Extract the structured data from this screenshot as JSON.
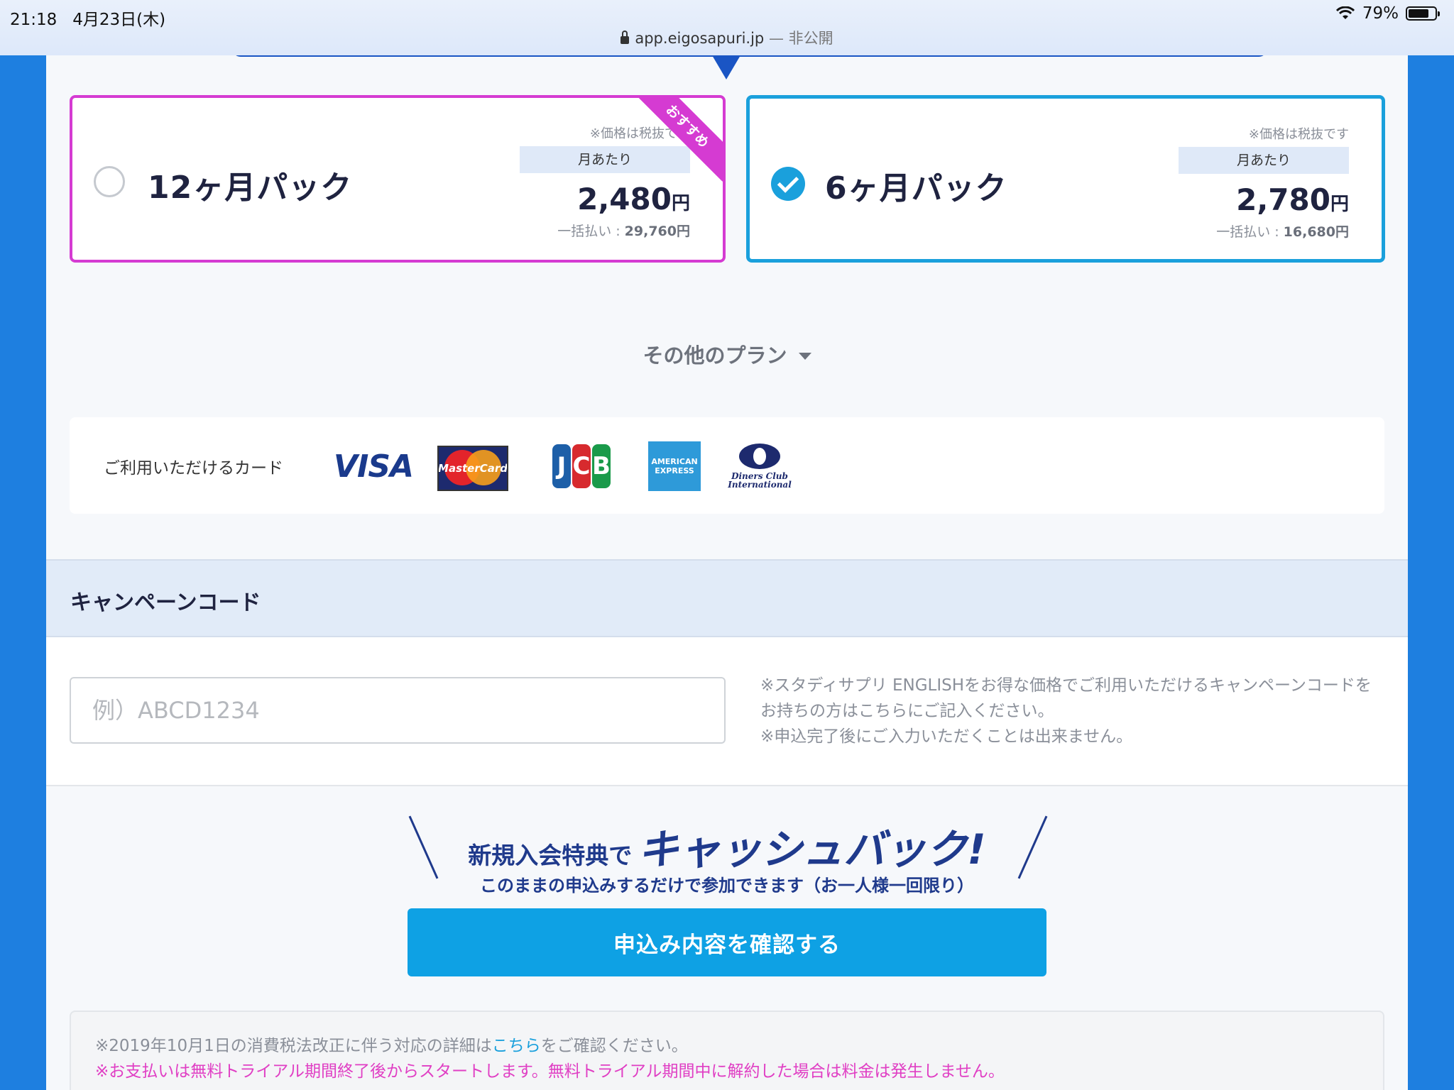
{
  "status_bar": {
    "time": "21:18",
    "date": "4月23日(木)",
    "battery": "79%",
    "battery_level": 0.79
  },
  "url_bar": {
    "domain": "app.eigosapuri.jp",
    "separator": " — ",
    "privacy": "非公開"
  },
  "plans": [
    {
      "name": "12ヶ月パック",
      "selected": false,
      "badge": "おすすめ",
      "tax_note": "※価格は税抜です",
      "per_month_label": "月あたり",
      "price": "2,480",
      "currency": "円",
      "lump_label": "一括払い : ",
      "lump_price": "29,760円",
      "border_color": "#d53bd2"
    },
    {
      "name": "6ヶ月パック",
      "selected": true,
      "tax_note": "※価格は税抜です",
      "per_month_label": "月あたり",
      "price": "2,780",
      "currency": "円",
      "lump_label": "一括払い : ",
      "lump_price": "16,680円",
      "border_color": "#1aa0dc"
    }
  ],
  "other_plans": {
    "label": "その他のプラン"
  },
  "cards": {
    "label": "ご利用いただけるカード",
    "brands": [
      {
        "name": "VISA",
        "icon": "visa-icon",
        "text": "VISA"
      },
      {
        "name": "MasterCard",
        "icon": "mastercard-icon",
        "text": "MasterCard"
      },
      {
        "name": "JCB",
        "icon": "jcb-icon",
        "letters": [
          "J",
          "C",
          "B"
        ]
      },
      {
        "name": "American Express",
        "icon": "amex-icon",
        "text_top": "AMERICAN",
        "text_bottom": "EXPRESS"
      },
      {
        "name": "Diners Club International",
        "icon": "diners-icon",
        "text_top": "Diners Club",
        "text_bottom": "International"
      }
    ]
  },
  "campaign": {
    "title": "キャンペーンコード",
    "placeholder": "例）ABCD1234",
    "value": "",
    "note_1": "※スタディサプリ ENGLISHをお得な価格でご利用いただけるキャンペーンコードをお持ちの方はこちらにご記入ください。",
    "note_2": "※申込完了後にご入力いただくことは出来ません。"
  },
  "cashback": {
    "lead": "新規入会特典で",
    "highlight": "キャッシュバック!",
    "sub": "このままの申込みするだけで参加できます（お一人様一回限り）"
  },
  "submit": {
    "label": "申込み内容を確認する"
  },
  "notice": {
    "line1_before": "※2019年10月1日の消費税法改正に伴う対応の詳細は",
    "line1_link": "こちら",
    "line1_after": "をご確認ください。",
    "line2": "※お支払いは無料トライアル期間終了後からスタートします。無料トライアル期間中に解約した場合は料金は発生しません。"
  },
  "colors": {
    "background": "#1e7fe0",
    "accent_blue": "#1aa0dc",
    "accent_pink": "#d53bd2",
    "button": "#0ea1e4",
    "navy": "#1f3a8c"
  }
}
